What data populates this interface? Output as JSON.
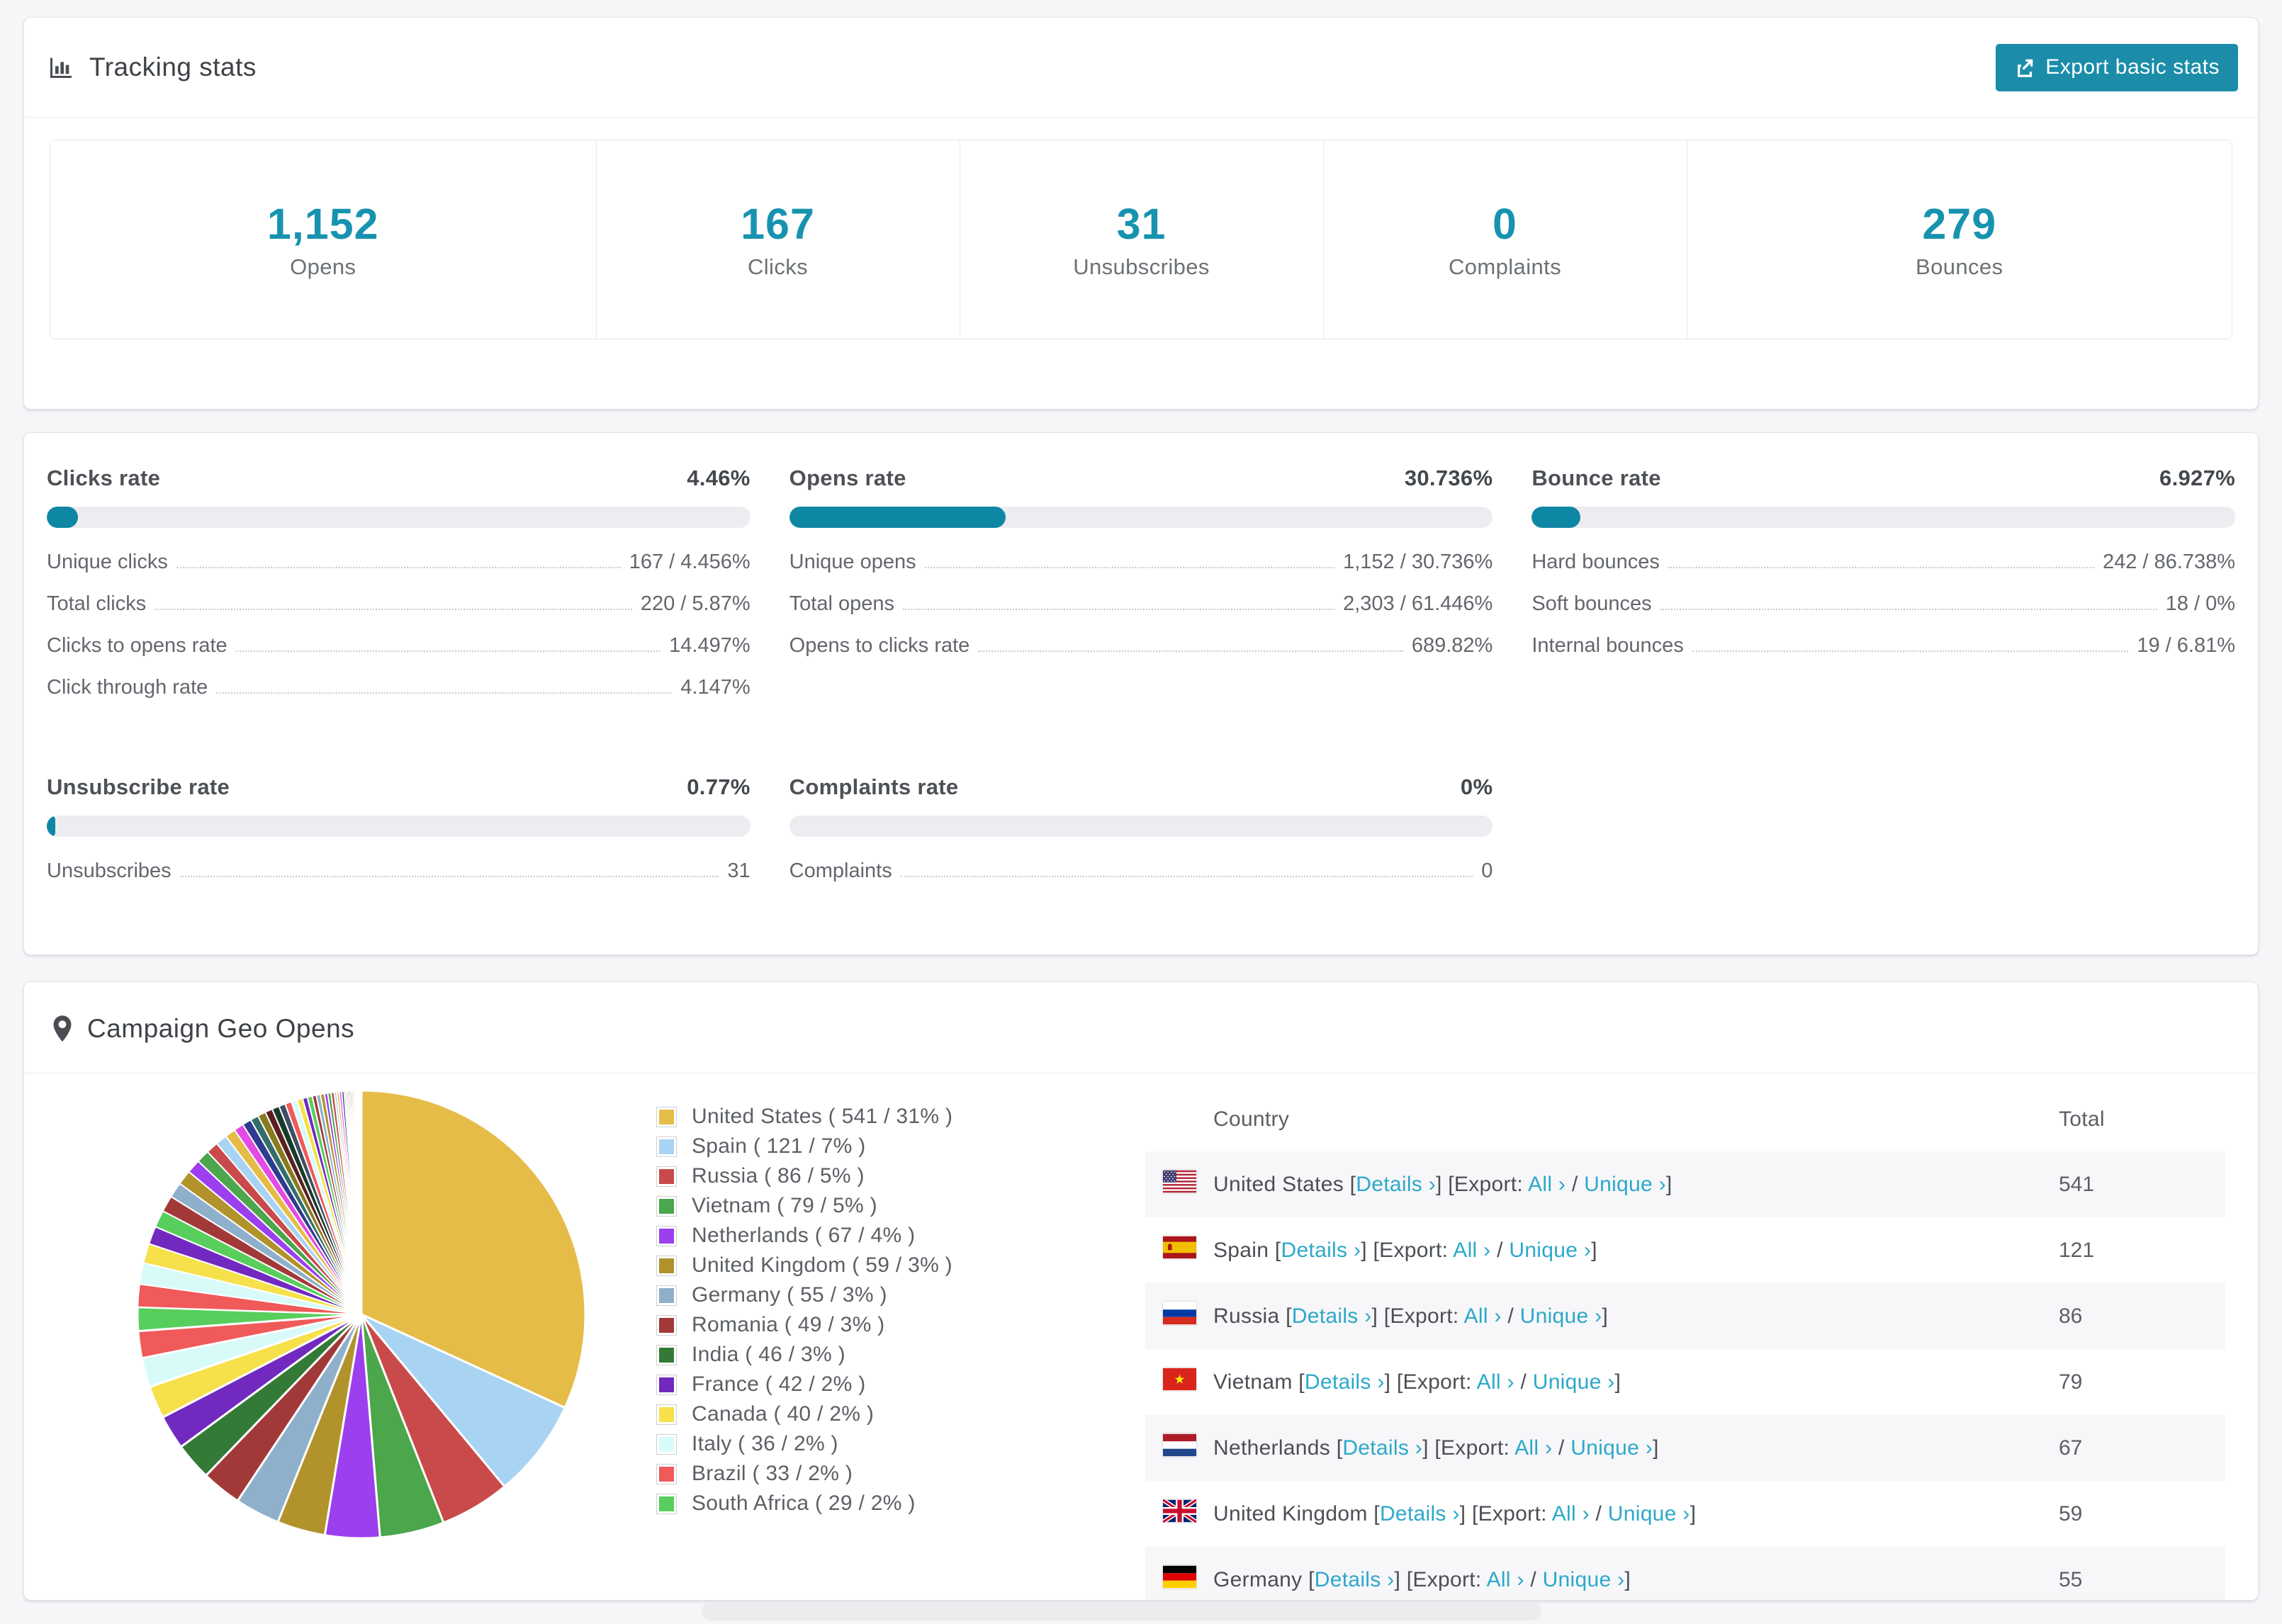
{
  "colors": {
    "accent_number": "#1793AF",
    "accent_bar": "#0E87A4",
    "accent_button": "#1B8DA9",
    "link": "#2CA8CA",
    "bar_track": "#ECEDF1",
    "page_bg": "#f6f6f8"
  },
  "tracking": {
    "title": "Tracking stats",
    "export_label": "Export basic stats",
    "tiles": [
      {
        "value": "1,152",
        "label": "Opens"
      },
      {
        "value": "167",
        "label": "Clicks"
      },
      {
        "value": "31",
        "label": "Unsubscribes"
      },
      {
        "value": "0",
        "label": "Complaints"
      },
      {
        "value": "279",
        "label": "Bounces"
      }
    ]
  },
  "rates": [
    {
      "title": "Clicks rate",
      "value": "4.46%",
      "pct": 4.46,
      "rows": [
        [
          "Unique clicks",
          "167 / 4.456%"
        ],
        [
          "Total clicks",
          "220 / 5.87%"
        ],
        [
          "Clicks to opens rate",
          "14.497%"
        ],
        [
          "Click through rate",
          "4.147%"
        ]
      ]
    },
    {
      "title": "Opens rate",
      "value": "30.736%",
      "pct": 30.736,
      "rows": [
        [
          "Unique opens",
          "1,152 / 30.736%"
        ],
        [
          "Total opens",
          "2,303 / 61.446%"
        ],
        [
          "Opens to clicks rate",
          "689.82%"
        ]
      ]
    },
    {
      "title": "Bounce rate",
      "value": "6.927%",
      "pct": 6.927,
      "rows": [
        [
          "Hard bounces",
          "242 / 86.738%"
        ],
        [
          "Soft bounces",
          "18 / 0%"
        ],
        [
          "Internal bounces",
          "19 / 6.81%"
        ]
      ]
    },
    {
      "title": "Unsubscribe rate",
      "value": "0.77%",
      "pct": 0.77,
      "rows": [
        [
          "Unsubscribes",
          "31"
        ]
      ]
    },
    {
      "title": "Complaints rate",
      "value": "0%",
      "pct": 0,
      "rows": [
        [
          "Complaints",
          "0"
        ]
      ]
    }
  ],
  "geo": {
    "title": "Campaign Geo Opens",
    "table": {
      "country_header": "Country",
      "total_header": "Total",
      "details_label": "Details",
      "export_label": "Export:",
      "all_label": "All",
      "unique_label": "Unique",
      "chevron": "›",
      "rows": [
        {
          "country": "United States",
          "flag": "us",
          "total": "541"
        },
        {
          "country": "Spain",
          "flag": "es",
          "total": "121"
        },
        {
          "country": "Russia",
          "flag": "ru",
          "total": "86"
        },
        {
          "country": "Vietnam",
          "flag": "vn",
          "total": "79"
        },
        {
          "country": "Netherlands",
          "flag": "nl",
          "total": "67"
        },
        {
          "country": "United Kingdom",
          "flag": "gb",
          "total": "59"
        },
        {
          "country": "Germany",
          "flag": "de",
          "total": "55"
        }
      ]
    }
  },
  "chart_data": {
    "type": "pie",
    "title": "Campaign Geo Opens",
    "legend_position": "right",
    "start_angle_deg": -90,
    "direction": "clockwise",
    "categories": [
      "United States",
      "Spain",
      "Russia",
      "Vietnam",
      "Netherlands",
      "United Kingdom",
      "Germany",
      "Romania",
      "India",
      "France",
      "Canada",
      "Italy",
      "Brazil",
      "South Africa"
    ],
    "values": [
      541,
      121,
      86,
      79,
      67,
      59,
      55,
      49,
      46,
      42,
      40,
      36,
      33,
      29
    ],
    "percents": [
      31,
      7,
      5,
      5,
      4,
      3,
      3,
      3,
      3,
      2,
      2,
      2,
      2,
      2
    ],
    "legend_labels": [
      "United States ( 541 / 31% )",
      "Spain ( 121 / 7% )",
      "Russia ( 86 / 5% )",
      "Vietnam ( 79 / 5% )",
      "Netherlands ( 67 / 4% )",
      "United Kingdom ( 59 / 3% )",
      "Germany ( 55 / 3% )",
      "Romania ( 49 / 3% )",
      "India ( 46 / 3% )",
      "France ( 42 / 2% )",
      "Canada ( 40 / 2% )",
      "Italy ( 36 / 2% )",
      "Brazil ( 33 / 2% )",
      "South Africa ( 29 / 2% )"
    ],
    "colors": [
      "#E6BC48",
      "#A9D3F2",
      "#C94A4A",
      "#4CA64C",
      "#9C3FEF",
      "#B2922B",
      "#8FB0CB",
      "#A23939",
      "#337A36",
      "#7229C0",
      "#F6E04B",
      "#D8FBFA",
      "#F05A5A",
      "#58CE5C"
    ],
    "others_estimated": [
      28,
      26,
      24,
      22,
      21,
      20,
      19,
      18,
      17,
      16,
      15,
      14,
      13,
      12,
      11,
      10,
      10,
      9,
      9,
      8,
      8,
      7,
      7,
      6,
      6,
      5,
      5,
      5,
      4,
      4,
      4,
      3,
      3,
      3,
      3,
      2,
      2,
      2,
      2,
      2,
      2,
      1,
      1,
      1,
      1,
      1,
      1,
      1,
      1,
      1
    ],
    "others_colors": [
      "#F05A5A",
      "#D8FBFA",
      "#F6E04B",
      "#7229C0",
      "#58CE5C",
      "#A23939",
      "#8FB0CB",
      "#B2922B",
      "#9C3FEF",
      "#4CA64C",
      "#C94A4A",
      "#A9D3F2",
      "#E6BC48",
      "#E44AE4",
      "#2F3B8F",
      "#336E6B",
      "#8A7A1E",
      "#5C1F1F",
      "#173B2B",
      "#3E4E63"
    ]
  }
}
